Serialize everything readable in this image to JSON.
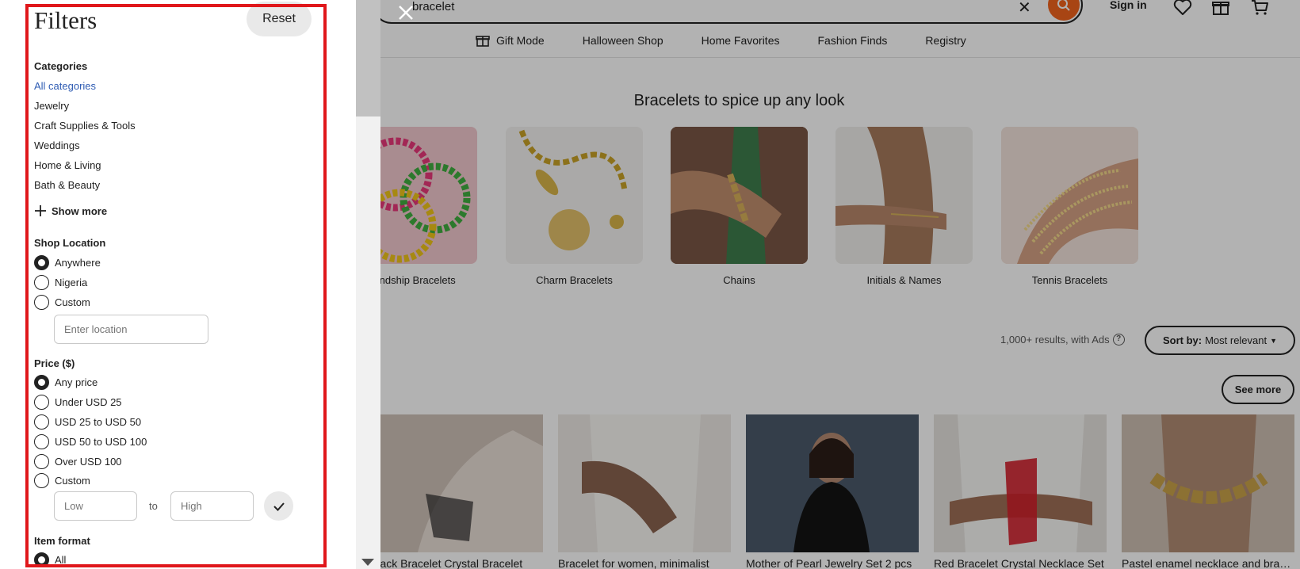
{
  "header": {
    "search_value": "bracelet",
    "sign_in": "Sign in"
  },
  "nav": {
    "items": [
      "Gift Mode",
      "Halloween Shop",
      "Home Favorites",
      "Fashion Finds",
      "Registry"
    ]
  },
  "main": {
    "section_title": "Bracelets to spice up any look",
    "categories": [
      {
        "label": "Friendship Bracelets",
        "icon": "friendship-bracelets-image"
      },
      {
        "label": "Charm Bracelets",
        "icon": "charm-bracelets-image"
      },
      {
        "label": "Chains",
        "icon": "chains-image"
      },
      {
        "label": "Initials & Names",
        "icon": "initials-names-image"
      },
      {
        "label": "Tennis Bracelets",
        "icon": "tennis-bracelets-image"
      }
    ],
    "results_text": "1,000+ results, with Ads",
    "help_glyph": "?",
    "sort_prefix": "Sort by:",
    "sort_value": "Most relevant",
    "see_more": "See more",
    "products": [
      {
        "title": "Black Bracelet Crystal Bracelet"
      },
      {
        "title": "Bracelet for women, minimalist"
      },
      {
        "title": "Mother of Pearl Jewelry Set 2 pcs"
      },
      {
        "title": "Red Bracelet Crystal Necklace Set"
      },
      {
        "title": "Pastel enamel necklace and bracelet"
      }
    ]
  },
  "filters": {
    "title": "Filters",
    "reset": "Reset",
    "categories": {
      "heading": "Categories",
      "items": [
        "All categories",
        "Jewelry",
        "Craft Supplies & Tools",
        "Weddings",
        "Home & Living",
        "Bath & Beauty"
      ],
      "active_index": 0,
      "show_more": "Show more"
    },
    "shop_location": {
      "heading": "Shop Location",
      "options": [
        "Anywhere",
        "Nigeria",
        "Custom"
      ],
      "selected": "Anywhere",
      "location_placeholder": "Enter location"
    },
    "price": {
      "heading": "Price ($)",
      "options": [
        "Any price",
        "Under USD 25",
        "USD 25 to USD 50",
        "USD 50 to USD 100",
        "Over USD 100",
        "Custom"
      ],
      "selected": "Any price",
      "low_placeholder": "Low",
      "high_placeholder": "High",
      "to_label": "to"
    },
    "item_format": {
      "heading": "Item format",
      "options": [
        "All"
      ],
      "selected": "All"
    }
  },
  "colors": {
    "brand_orange": "#f1641e",
    "active_link": "#2f5cb3",
    "highlight_border": "#e0171b"
  }
}
